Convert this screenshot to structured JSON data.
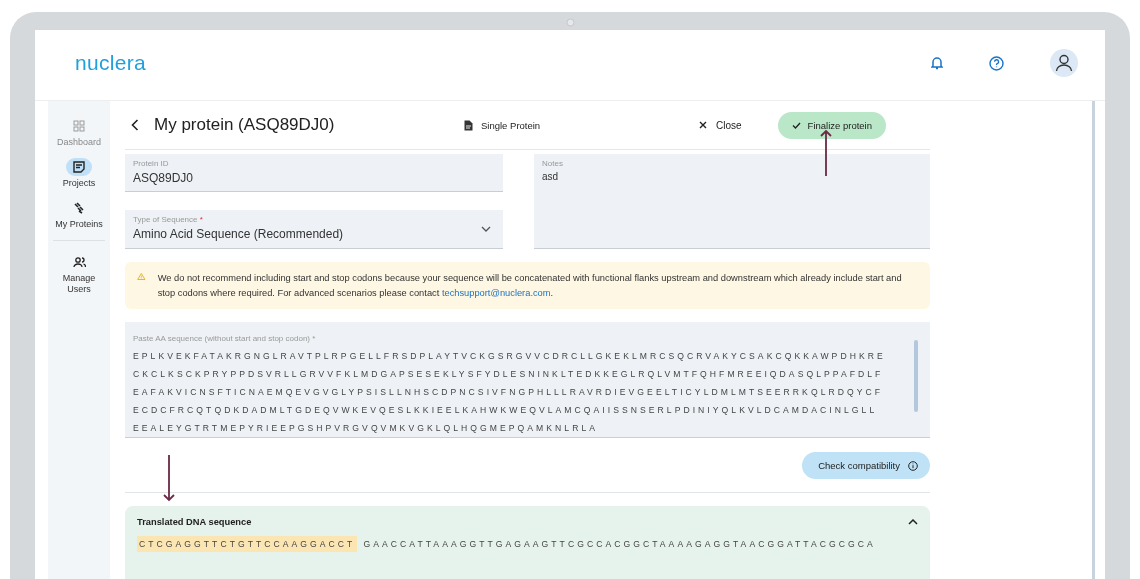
{
  "logo": "nuclera",
  "sidebar": {
    "items": [
      {
        "label": "Dashboard",
        "selected": false
      },
      {
        "label": "Projects",
        "selected": true
      },
      {
        "label": "My Proteins",
        "selected": false
      },
      {
        "label": "Manage Users",
        "selected": false
      }
    ]
  },
  "page": {
    "title": "My protein (ASQ89DJ0)",
    "mode": "Single Protein",
    "close": "Close",
    "finalize": "Finalize protein"
  },
  "fields": {
    "protein_id": {
      "label": "Protein ID",
      "value": "ASQ89DJ0"
    },
    "sequence_type": {
      "label": "Type of Sequence",
      "required_mark": "*",
      "value": "Amino Acid Sequence (Recommended)"
    },
    "notes": {
      "label": "Notes",
      "value": "asd"
    }
  },
  "warning": {
    "text": "We do not recommend including start and stop codons because your sequence will be concatenated with functional flanks upstream and downstream which already include start and stop codons where required. For advanced scenarios please contact",
    "link": "techsupport@nuclera.com",
    "after": "."
  },
  "aa_sequence": {
    "label": "Paste AA sequence (without start and stop codon) *",
    "lines": [
      "EPLKVEKFATAKRGNGLRAVTPLRPGELLFRSDPLAYTVCKGSRGVVCDRCLLGKEKLMRCSQCRVAKYCSAKCQKKAWPDHKRE",
      "CKCLKSCKPRYPPDSVRLLGRVVFKLMDGAPSESEKLYSFYDLESNINKLTEDKKEGLRQLVMTFQHFMREEIQDASQLPPAFDLF",
      "EAFAKVICNSFTICNAEMQEVGVGLYPSISLLNHSCDPNCSIVFNGPHLLLRAVRDIEVGEELTICYLDMLMTSEERRKQLRDQYCF",
      "ECDCFRCQTQDKDADMLTGDEQVWKEVQESLKKIEELKAHWKWEQVLAMCQAIISSNSERLPDINIYQLKVLDCAMDACINLGLL",
      "EEALEYGTRTMEPYRIEEPGSHPVRGVQVMKVGKLQLHQGMEPQAMKNLRLA"
    ]
  },
  "check_button": "Check compatibility",
  "dna": {
    "title": "Translated DNA sequence",
    "expanded": true,
    "highlighted": "CTCGAGGTTCTGTTCCAAGGACCT",
    "rest": "GAACCATTAAAGGTTGAGAAGTTCGCCACGGCTAAAAGAGGTAACGGATTACGCGCA"
  }
}
